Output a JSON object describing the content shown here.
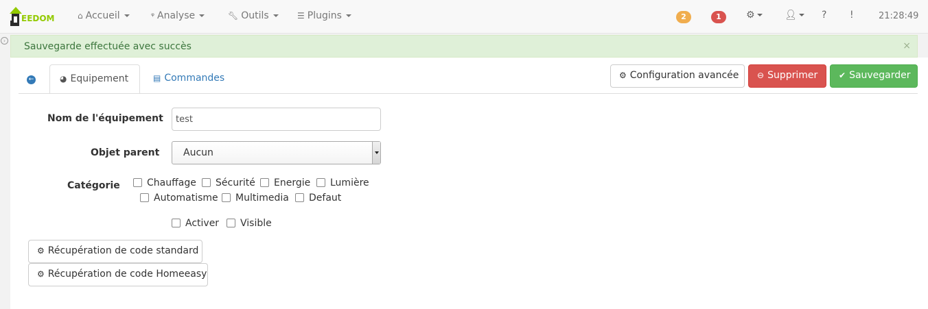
{
  "navbar": {
    "logo_text": "EEDOM",
    "menu": [
      {
        "label": "Accueil",
        "icon": "home-icon"
      },
      {
        "label": "Analyse",
        "icon": "stethoscope-icon"
      },
      {
        "label": "Outils",
        "icon": "wrench-icon"
      },
      {
        "label": "Plugins",
        "icon": "list-icon"
      }
    ],
    "badges": {
      "warning": "2",
      "danger": "1"
    },
    "clock": "21:28:49"
  },
  "alert": {
    "message": "Sauvegarde effectuée avec succès",
    "close": "×"
  },
  "tabs": {
    "equipement": "Equipement",
    "commandes": "Commandes"
  },
  "actions": {
    "config": "Configuration avancée",
    "delete": "Supprimer",
    "save": "Sauvegarder"
  },
  "form": {
    "name_label": "Nom de l'équipement",
    "name_value": "test",
    "parent_label": "Objet parent",
    "parent_value": "Aucun",
    "category_label": "Catégorie",
    "categories": [
      "Chauffage",
      "Sécurité",
      "Energie",
      "Lumière",
      "Automatisme",
      "Multimedia",
      "Defaut"
    ],
    "activate": "Activer",
    "visible": "Visible"
  },
  "buttons": {
    "standard": "Récupération de code standard",
    "homeeasy": "Récupération de code Homeeasy"
  },
  "colors": {
    "brand_green": "#93ca02",
    "success": "#5cb85c",
    "danger": "#d9534f",
    "warning": "#f0ad4e",
    "link": "#337ab7"
  }
}
